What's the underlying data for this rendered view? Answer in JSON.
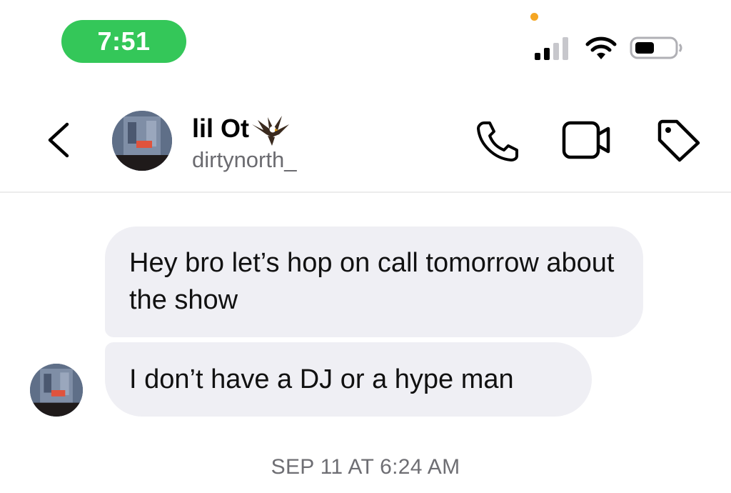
{
  "status_bar": {
    "time": "7:51",
    "time_pill_color": "#34c759",
    "privacy_indicator_color": "#f5a623",
    "signal_icon": "signal-bars-icon",
    "wifi_icon": "wifi-icon",
    "battery_icon": "battery-icon"
  },
  "header": {
    "back_icon": "chevron-left-icon",
    "contact_name": "lil Ot",
    "contact_emoji": "eagle-icon",
    "contact_handle": "dirtynorth_",
    "actions": [
      "phone-icon",
      "video-camera-icon",
      "tag-icon"
    ]
  },
  "messages": [
    {
      "text": "Hey bro let’s hop on call tomorrow about the show",
      "sender": "contact"
    },
    {
      "text": "I don’t have a DJ or a hype man",
      "sender": "contact"
    }
  ],
  "timestamp": "SEP 11 AT 6:24 AM"
}
